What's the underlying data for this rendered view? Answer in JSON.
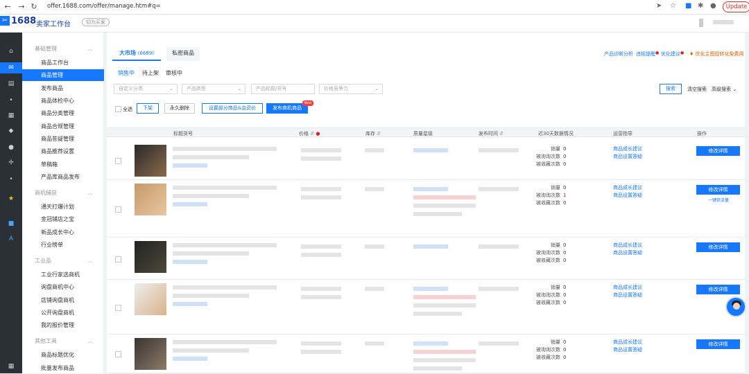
{
  "browser": {
    "url": "offer.1688.com/offer/manage.htm#q=",
    "update_label": "Update"
  },
  "header": {
    "logo_number": "1688",
    "app_title": "卖家工作台",
    "switch_label": "切为买家"
  },
  "sidebar": {
    "sections": [
      {
        "title": "基础管理",
        "items": [
          "商品工作台",
          "商品管理",
          "发布商品",
          "商品体检中心",
          "商品分类管理",
          "商品合规管理",
          "商品答疑管理",
          "商品推荐设置",
          "草稿箱",
          "产品库商品发布"
        ]
      },
      {
        "title": "商机捕获",
        "items": [
          "通天打爆计划",
          "金冠铺店之宝",
          "新品成长中心",
          "行业榜单"
        ]
      },
      {
        "title": "工业品",
        "items": [
          "工业行家选商机",
          "询盘商机中心",
          "店铺询盘商机",
          "公开询盘商机",
          "我的报价管理"
        ]
      },
      {
        "title": "其他工具",
        "items": [
          "商品标题优化",
          "批量发布商品"
        ]
      }
    ],
    "active_item": "商品管理"
  },
  "tabs": {
    "market_label": "大市场",
    "market_count": "(6689)",
    "private_label": "私密商品"
  },
  "top_links": {
    "diagnosis": "产品诊断分析",
    "violation": "违规提醒",
    "optimize": "优化建议",
    "promo": "优化主图捉转化免费用"
  },
  "sub_tabs": [
    "销售中",
    "待上架",
    "审核中"
  ],
  "filters": {
    "category": "自定义分类",
    "type": "产品类型",
    "title_placeholder": "产品标题/货号",
    "price": "价格竞争力",
    "search": "搜索",
    "clear": "清空搜索",
    "advanced": "高级搜索"
  },
  "actions": {
    "select_all": "全选",
    "take_down": "下架",
    "delete": "永久删除",
    "member_price": "设置部分商品&会员价",
    "publish": "发布商机商品",
    "new_badge": "New"
  },
  "table": {
    "headers": {
      "title": "标题货号",
      "price": "价格",
      "stock": "库存",
      "quality": "质量星级",
      "publish_time": "发布时间",
      "stats": "近30天数据情况",
      "operation_guide": "运营指导",
      "actions": "操作"
    },
    "stat_labels": {
      "sales": "销量",
      "inquiries": "被询询次数",
      "favorites": "被收藏次数"
    },
    "op_links": {
      "growth": "商品成长建议",
      "setting": "商品设置答疑"
    },
    "edit_label": "修改详情",
    "one_click_label": "一键获流量",
    "rows": [
      {
        "sales": "0",
        "inquiries": "0",
        "favorites": "0",
        "inq_red": false
      },
      {
        "sales": "0",
        "inquiries": "1",
        "favorites": "0",
        "inq_red": true
      },
      {
        "sales": "0",
        "inquiries": "0",
        "favorites": "0",
        "inq_red": false
      },
      {
        "sales": "0",
        "inquiries": "0",
        "favorites": "0",
        "inq_red": false
      },
      {
        "sales": "0",
        "inquiries": "0",
        "favorites": "0",
        "inq_red": false
      }
    ]
  },
  "colors": {
    "primary": "#1677ff",
    "rail": "#2b3036",
    "alert": "#e02020"
  }
}
